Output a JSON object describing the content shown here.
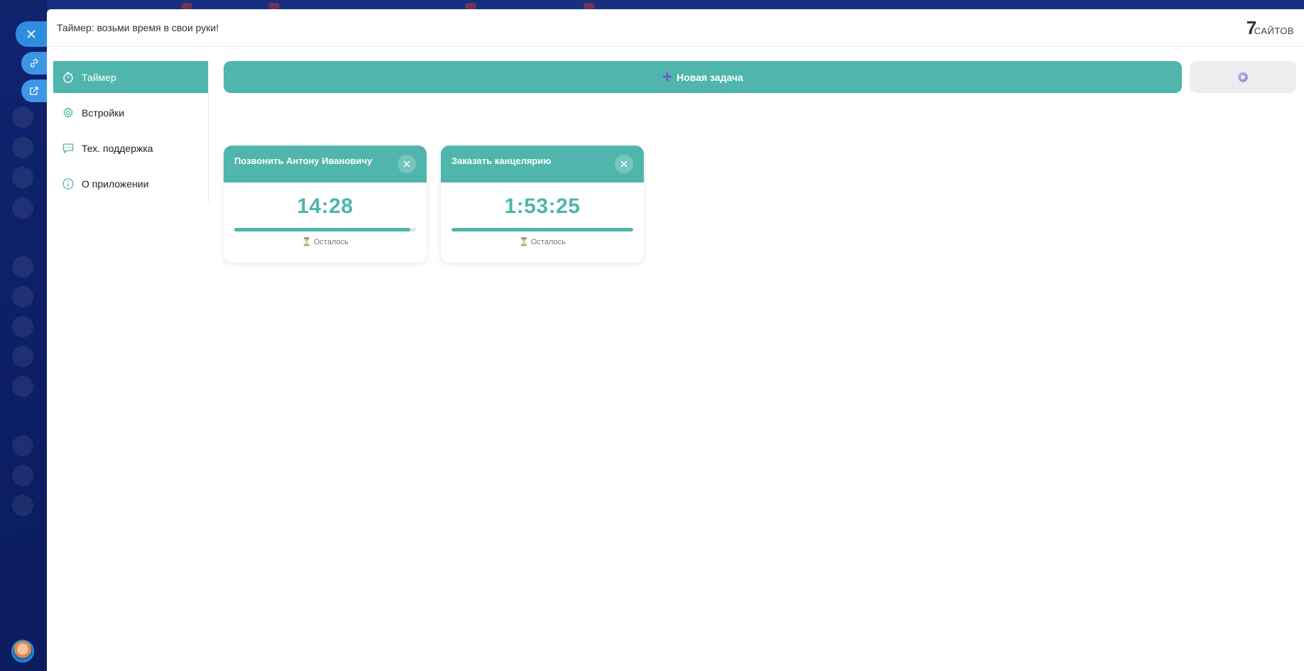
{
  "window": {
    "title": "Таймер: возьми время в свои руки!",
    "logo_digit": "7",
    "logo_text": "САЙТОВ"
  },
  "nav": {
    "items": [
      {
        "label": "Таймер",
        "icon": "stopwatch-icon",
        "active": true
      },
      {
        "label": "Встройки",
        "icon": "gear-icon",
        "active": false
      },
      {
        "label": "Тех. поддержка",
        "icon": "chat-icon",
        "active": false
      },
      {
        "label": "О приложении",
        "icon": "info-icon",
        "active": false
      }
    ]
  },
  "toolbar": {
    "new_task_label": "Новая задача",
    "new_task_icon": "plus-icon",
    "settings_icon": "gear-icon"
  },
  "tasks": [
    {
      "title": "Позвонить Антону Ивановичу",
      "time": "14:28",
      "progress": 0.97,
      "remaining_label": "Осталось"
    },
    {
      "title": "Заказать канцелярию",
      "time": "1:53:25",
      "progress": 1.0,
      "remaining_label": "Осталось"
    }
  ],
  "colors": {
    "accent": "#4fb5ad",
    "plus": "#7a4fd0",
    "side_button": "#2f8de0"
  }
}
